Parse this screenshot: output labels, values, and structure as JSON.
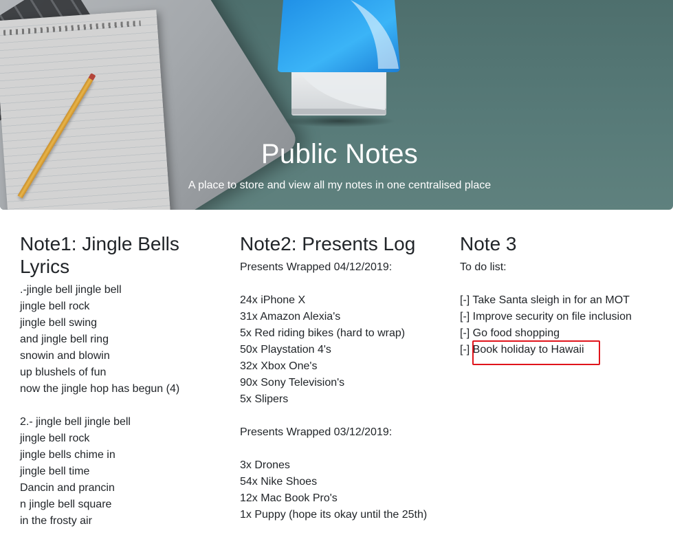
{
  "colors": {
    "hero_background": "#577a78",
    "logo_blue": "#2aa3f0",
    "highlight_red": "#e0141b"
  },
  "hero": {
    "logo_icon": "notes-app-icon",
    "title": "Public Notes",
    "tagline": "A place to store and view all my notes in one centralised place"
  },
  "notes": [
    {
      "title": "Note1: Jingle Bells Lyrics",
      "body": ".-jingle bell jingle bell\njingle bell rock\njingle bell swing\nand jingle bell ring\nsnowin and blowin\nup blushels of fun\nnow the jingle hop has begun (4)\n\n2.- jingle bell jingle bell\njingle bell rock\njingle bells chime in\njingle bell time\nDancin and prancin\nn jingle bell square\nin the frosty air"
    },
    {
      "title": "Note2: Presents Log",
      "body": "Presents Wrapped 04/12/2019:\n\n24x iPhone X\n31x Amazon Alexia's\n5x Red riding bikes (hard to wrap)\n50x Playstation 4's\n32x Xbox One's\n90x Sony Television's\n5x Slipers\n\nPresents Wrapped 03/12/2019:\n\n3x Drones\n54x Nike Shoes\n12x Mac Book Pro's\n1x Puppy (hope its okay until the 25th)"
    },
    {
      "title": "Note 3",
      "body": "To do list:\n\n[-] Take Santa sleigh in for an MOT\n[-] Improve security on file inclusion\n[-] Go food shopping\n[-] Book holiday to Hawaii"
    }
  ]
}
